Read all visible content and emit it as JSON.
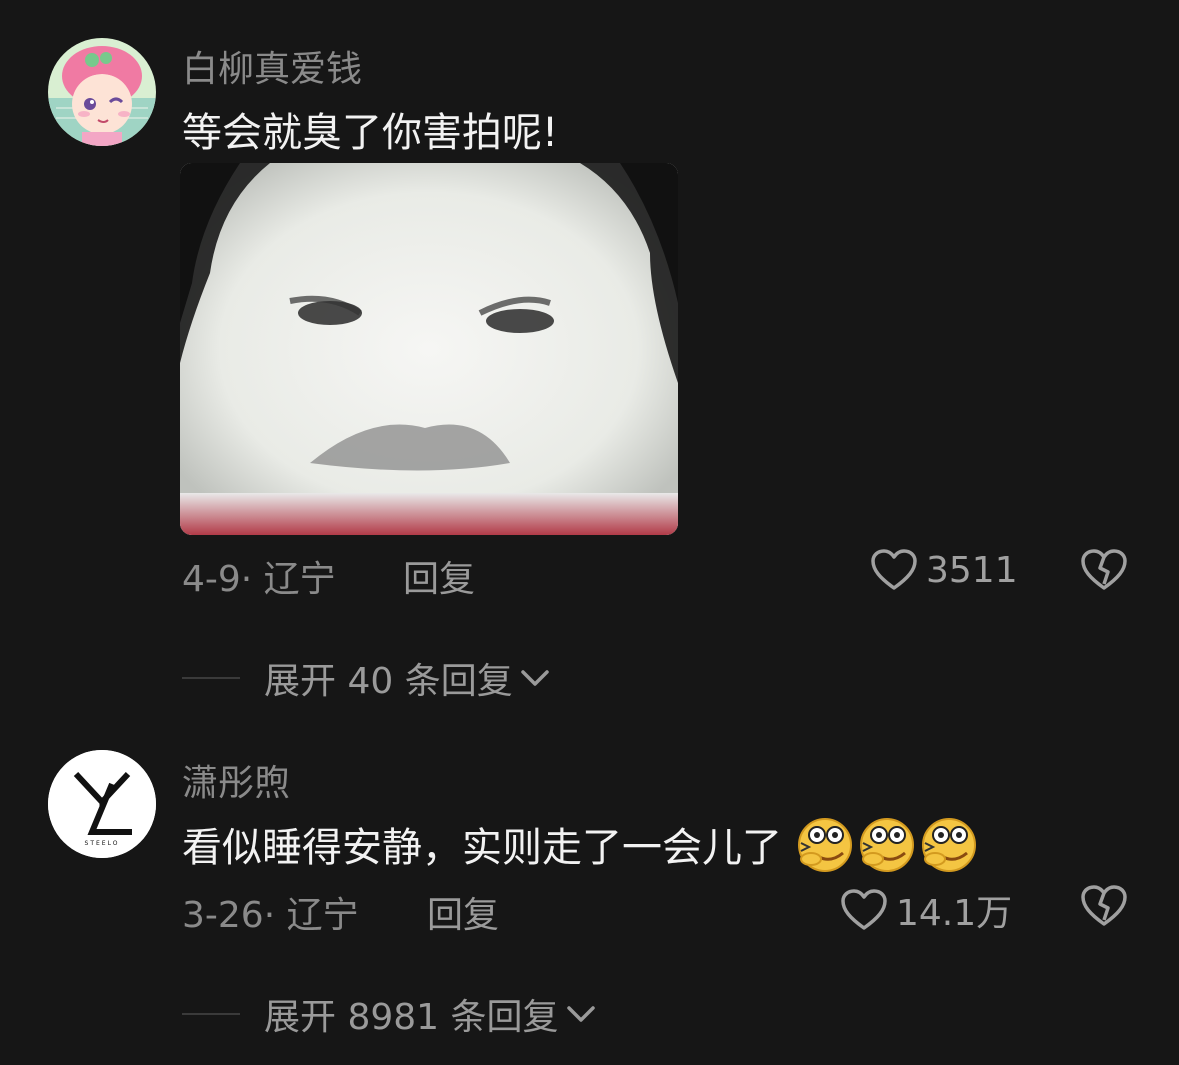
{
  "comments": [
    {
      "username": "白柳真爱钱",
      "text": "等会就臭了你害拍呢!",
      "date_location": "4-9· 辽宁",
      "reply_label": "回复",
      "likes": "3511",
      "expand_label": "展开 40 条回复",
      "avatar_icon": "cartoon-girl-avatar",
      "has_image": true
    },
    {
      "username": "潇彤煦",
      "text": "看似睡得安静，实则走了一会儿了",
      "emoji_count": 3,
      "date_location": "3-26· 辽宁",
      "reply_label": "回复",
      "likes": "14.1万",
      "expand_label": "展开 8981 条回复",
      "avatar_icon": "yl-logo-avatar",
      "avatar_text": "STEELO"
    }
  ],
  "colors": {
    "background": "#161616",
    "username": "#8a8a8a",
    "text": "#f2f2f2"
  }
}
